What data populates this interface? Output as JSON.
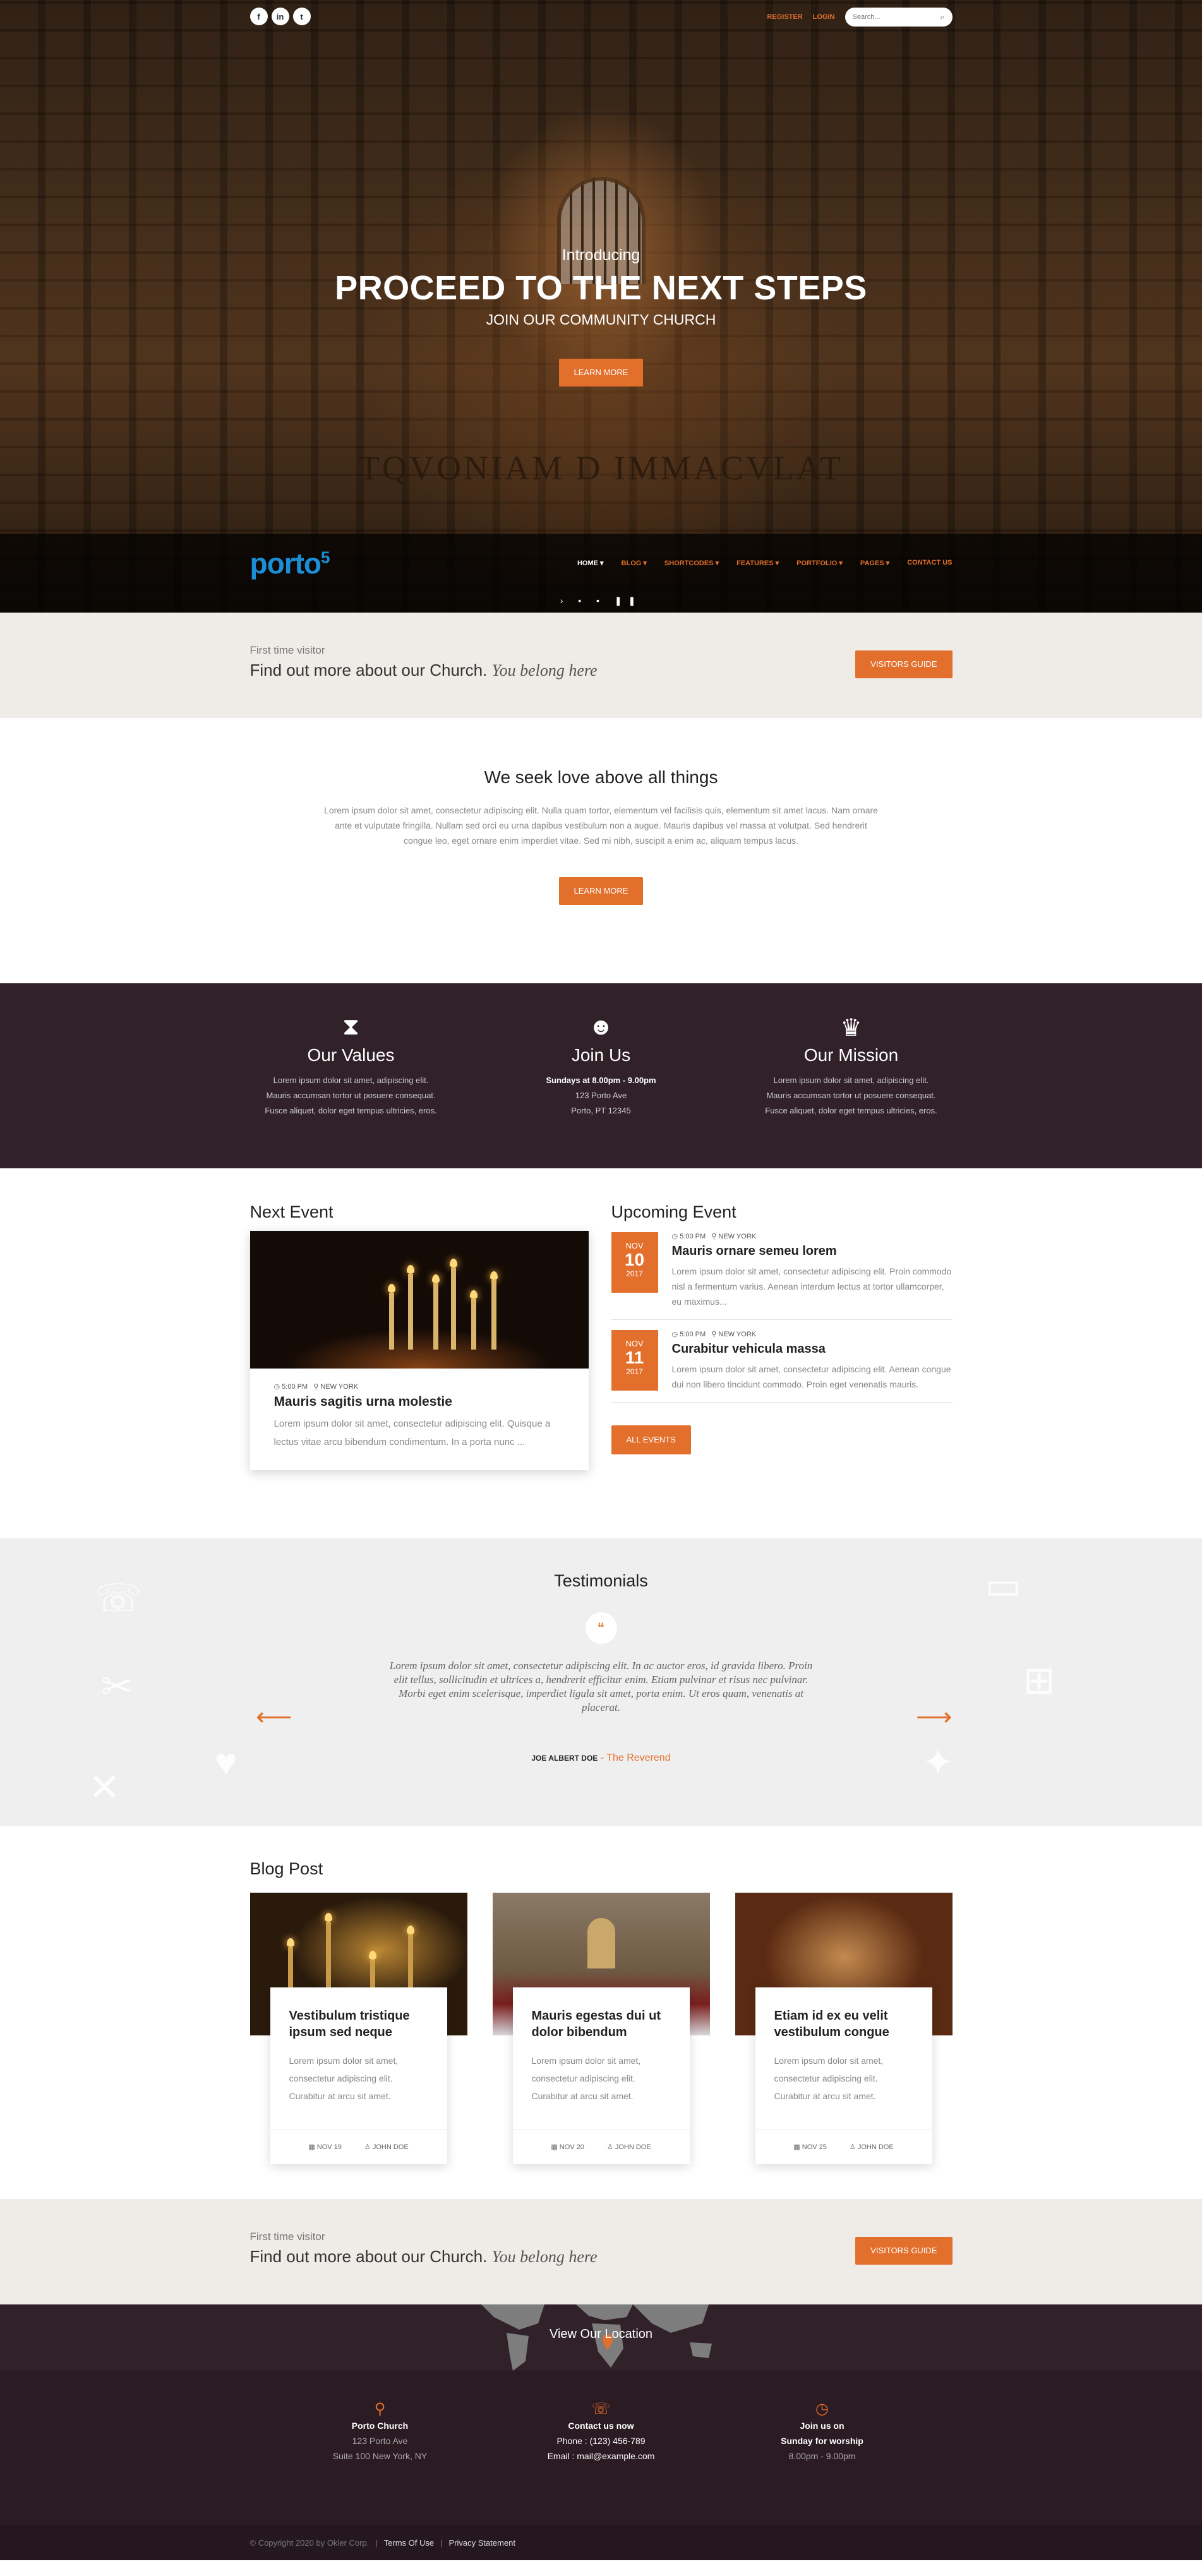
{
  "colors": {
    "accent": "#e36f2c",
    "dark": "#31222a",
    "light": "#efebe6",
    "logo": "#1b8ed6"
  },
  "topbar": {
    "social": [
      {
        "icon": "facebook-icon",
        "glyph": "f"
      },
      {
        "icon": "linkedin-icon",
        "glyph": "in"
      },
      {
        "icon": "twitter-icon",
        "glyph": "t"
      }
    ],
    "register": "REGISTER",
    "login": "LOGIN",
    "search_placeholder": "Search..."
  },
  "hero": {
    "intro": "Introducing",
    "title": "PROCEED TO THE NEXT STEPS",
    "subtitle": "JOIN OUR COMMUNITY CHURCH",
    "button": "LEARN MORE",
    "inscription": "TQVONIAM D IMMACVLAT"
  },
  "nav": {
    "logo": "porto",
    "logo_sup": "5",
    "items": [
      "HOME",
      "BLOG",
      "SHORTCODES",
      "FEATURES",
      "PORTFOLIO",
      "PAGES",
      "CONTACT US"
    ],
    "slider_controls": "› • • ❚❚"
  },
  "visitor": {
    "small": "First time visitor",
    "big": "Find out more about our Church.",
    "italic": "You belong here",
    "button": "VISITORS GUIDE"
  },
  "love": {
    "title": "We seek love above all things",
    "text": "Lorem ipsum dolor sit amet, consectetur adipiscing elit. Nulla quam tortor, elementum vel facilisis quis, elementum sit amet lacus. Nam ornare ante et vulputate fringilla. Nullam sed orci eu urna dapibus vestibulum non a augue. Mauris dapibus vel massa at volutpat. Sed hendrerit congue leo, eget ornare enim imperdiet vitae. Sed mi nibh, suscipit a enim ac, aliquam tempus lacus.",
    "button": "LEARN MORE"
  },
  "values": [
    {
      "icon": "hourglass-icon",
      "glyph": "⧗",
      "title": "Our Values",
      "line1": "Lorem ipsum dolor sit amet, adipiscing elit.",
      "line2": "Mauris accumsan tortor ut posuere consequat.",
      "line3": "Fusce aliquet, dolor eget tempus ultricies, eros."
    },
    {
      "icon": "users-icon",
      "glyph": "☻",
      "title": "Join Us",
      "line1": "Sundays at 8.00pm - 9.00pm",
      "line2": "123 Porto Ave",
      "line3": "Porto, PT 12345"
    },
    {
      "icon": "trophy-icon",
      "glyph": "♛",
      "title": "Our Mission",
      "line1": "Lorem ipsum dolor sit amet, adipiscing elit.",
      "line2": "Mauris accumsan tortor ut posuere consequat.",
      "line3": "Fusce aliquet, dolor eget tempus ultricies, eros."
    }
  ],
  "events": {
    "next_title": "Next Event",
    "next": {
      "time": "5:00 PM",
      "place": "NEW YORK",
      "title": "Mauris sagitis urna molestie",
      "text": "Lorem ipsum dolor sit amet, consectetur adipiscing elit. Quisque a lectus vitae arcu bibendum condimentum. In a porta nunc ..."
    },
    "upcoming_title": "Upcoming Event",
    "upcoming": [
      {
        "month": "NOV",
        "day": "10",
        "year": "2017",
        "time": "5:00 PM",
        "place": "NEW YORK",
        "title": "Mauris ornare semeu lorem",
        "text": "Lorem ipsum dolor sit amet, consectetur adipiscing elit. Proin commodo nisl a fermentum varius. Aenean interdum lectus at tortor ullamcorper, eu maximus..."
      },
      {
        "month": "NOV",
        "day": "11",
        "year": "2017",
        "time": "5:00 PM",
        "place": "NEW YORK",
        "title": "Curabitur vehicula massa",
        "text": "Lorem ipsum dolor sit amet, consectetur adipiscing elit. Aenean congue dui non libero tincidunt commodo. Proin eget venenatis mauris."
      }
    ],
    "all_button": "ALL EVENTS"
  },
  "testimonials": {
    "title": "Testimonials",
    "quote_glyph": "“",
    "text": "Lorem ipsum dolor sit amet, consectetur adipiscing elit. In ac auctor eros, id gravida libero. Proin elit tellus, sollicitudin et ultrices a, hendrerit efficitur enim. Etiam pulvinar et risus nec pulvinar. Morbi eget enim scelerisque, imperdiet ligula sit amet, porta enim. Ut eros quam, venenatis at placerat.",
    "author": "JOE ALBERT DOE",
    "role": " - The Reverend"
  },
  "blog": {
    "title": "Blog Post",
    "posts": [
      {
        "title": "Vestibulum tristique ipsum sed neque",
        "text": "Lorem ipsum dolor sit amet, consectetur adipiscing elit. Curabitur at arcu sit amet.",
        "date": "NOV 19",
        "author": "JOHN DOE"
      },
      {
        "title": "Mauris egestas dui ut dolor bibendum",
        "text": "Lorem ipsum dolor sit amet, consectetur adipiscing elit. Curabitur at arcu sit amet.",
        "date": "NOV 20",
        "author": "JOHN DOE"
      },
      {
        "title": "Etiam id ex eu velit vestibulum congue",
        "text": "Lorem ipsum dolor sit amet, consectetur adipiscing elit. Curabitur at arcu sit amet.",
        "date": "NOV 25",
        "author": "JOHN DOE"
      }
    ]
  },
  "visitor2": {
    "small": "First time visitor",
    "big": "Find out more about our Church.",
    "italic": "You belong here",
    "button": "VISITORS GUIDE"
  },
  "location": {
    "label": "View Our Location"
  },
  "footer": [
    {
      "icon": "map-pin-icon",
      "glyph": "⚲",
      "title": "Porto Church",
      "line1": "123 Porto Ave",
      "line2": "Suite 100 New York, NY"
    },
    {
      "icon": "phone-icon",
      "glyph": "☏",
      "title": "Contact us now",
      "line1": "Phone : (123) 456-789",
      "line2": "Email : mail@example.com"
    },
    {
      "icon": "clock-icon",
      "glyph": "◷",
      "title": "Join us on",
      "line1": "Sunday for worship",
      "line2": "8.00pm - 9.00pm"
    }
  ],
  "copyright": {
    "text": "© Copyright 2020 by Okler Corp.",
    "terms": "Terms Of Use",
    "privacy": "Privacy Statement"
  }
}
